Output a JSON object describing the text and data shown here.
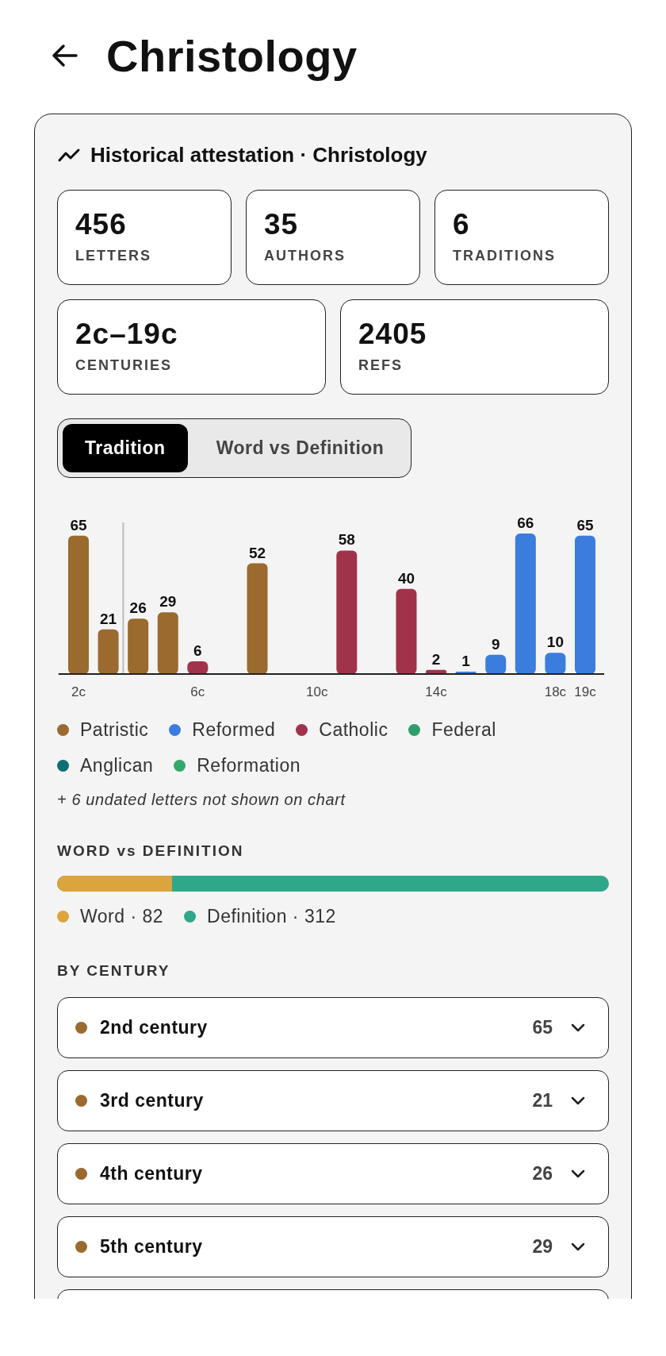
{
  "header": {
    "title": "Christology"
  },
  "card": {
    "title": "Historical attestation · Christology",
    "stats": [
      {
        "value": "456",
        "label": "LETTERS"
      },
      {
        "value": "35",
        "label": "AUTHORS"
      },
      {
        "value": "6",
        "label": "TRADITIONS"
      },
      {
        "value": "2c–19c",
        "label": "CENTURIES"
      },
      {
        "value": "2405",
        "label": "REFS"
      }
    ],
    "tabs": [
      {
        "label": "Tradition",
        "selected": true
      },
      {
        "label": "Word vs Definition",
        "selected": false
      }
    ],
    "chart_data": {
      "type": "bar",
      "data_labels": true,
      "x": [
        2,
        3,
        4,
        5,
        6,
        7,
        8,
        9,
        10,
        11,
        12,
        13,
        14,
        15,
        16,
        17,
        18,
        19
      ],
      "xlim": [
        1.33,
        19.64
      ],
      "ref_lines": [
        {
          "axis": "x",
          "value": 3.5
        }
      ],
      "series": [
        {
          "name": "Patristic",
          "color": "#9a6a2e",
          "values": [
            65,
            21,
            26,
            29,
            null,
            null,
            52,
            null,
            null,
            null,
            null,
            null,
            null,
            null,
            null,
            null,
            null,
            null
          ]
        },
        {
          "name": "Reformed",
          "color": "#3b7ddd",
          "values": [
            null,
            null,
            null,
            null,
            null,
            null,
            null,
            null,
            null,
            null,
            null,
            null,
            null,
            1,
            9,
            66,
            10,
            65
          ]
        },
        {
          "name": "Catholic",
          "color": "#a0334a",
          "values": [
            null,
            null,
            null,
            null,
            6,
            null,
            null,
            null,
            null,
            58,
            null,
            40,
            2,
            null,
            null,
            null,
            null,
            null
          ]
        },
        {
          "name": "Federal",
          "color": "#2e9e6a",
          "values": [
            null,
            null,
            null,
            null,
            null,
            null,
            null,
            null,
            null,
            null,
            null,
            null,
            null,
            null,
            null,
            null,
            null,
            null
          ]
        },
        {
          "name": "Anglican",
          "color": "#0f6e73",
          "values": [
            null,
            null,
            null,
            null,
            null,
            null,
            null,
            null,
            null,
            null,
            null,
            null,
            null,
            null,
            null,
            null,
            null,
            null
          ]
        },
        {
          "name": "Reformation",
          "color": "#34a86a",
          "values": [
            null,
            null,
            null,
            null,
            null,
            null,
            null,
            null,
            null,
            null,
            null,
            null,
            null,
            null,
            null,
            null,
            null,
            null
          ]
        }
      ],
      "xticks": [
        {
          "value": 2,
          "label": "2c"
        },
        {
          "value": 6,
          "label": "6c"
        },
        {
          "value": 10,
          "label": "10c"
        },
        {
          "value": 14,
          "label": "14c"
        },
        {
          "value": 18,
          "label": "18c"
        },
        {
          "value": 19,
          "label": "19c"
        }
      ]
    },
    "note": "+ 6 undated letters not shown on chart",
    "word_vs_definition": {
      "heading": "WORD vs DEFINITION",
      "level": 0.208,
      "items": [
        {
          "label": "Word · 82",
          "color": "#dba43c"
        },
        {
          "label": "Definition · 312",
          "color": "#2fa88a"
        }
      ]
    },
    "by_century": {
      "heading": "BY CENTURY",
      "rows": [
        {
          "kind": "row",
          "label": "2nd century",
          "count": "65",
          "color": "#9a6a2e"
        },
        {
          "kind": "row",
          "label": "3rd century",
          "count": "21",
          "color": "#9a6a2e"
        },
        {
          "kind": "row",
          "label": "4th century",
          "count": "26",
          "color": "#9a6a2e"
        },
        {
          "kind": "row",
          "label": "5th century",
          "count": "29",
          "color": "#9a6a2e"
        },
        {
          "kind": "partial"
        }
      ]
    }
  }
}
